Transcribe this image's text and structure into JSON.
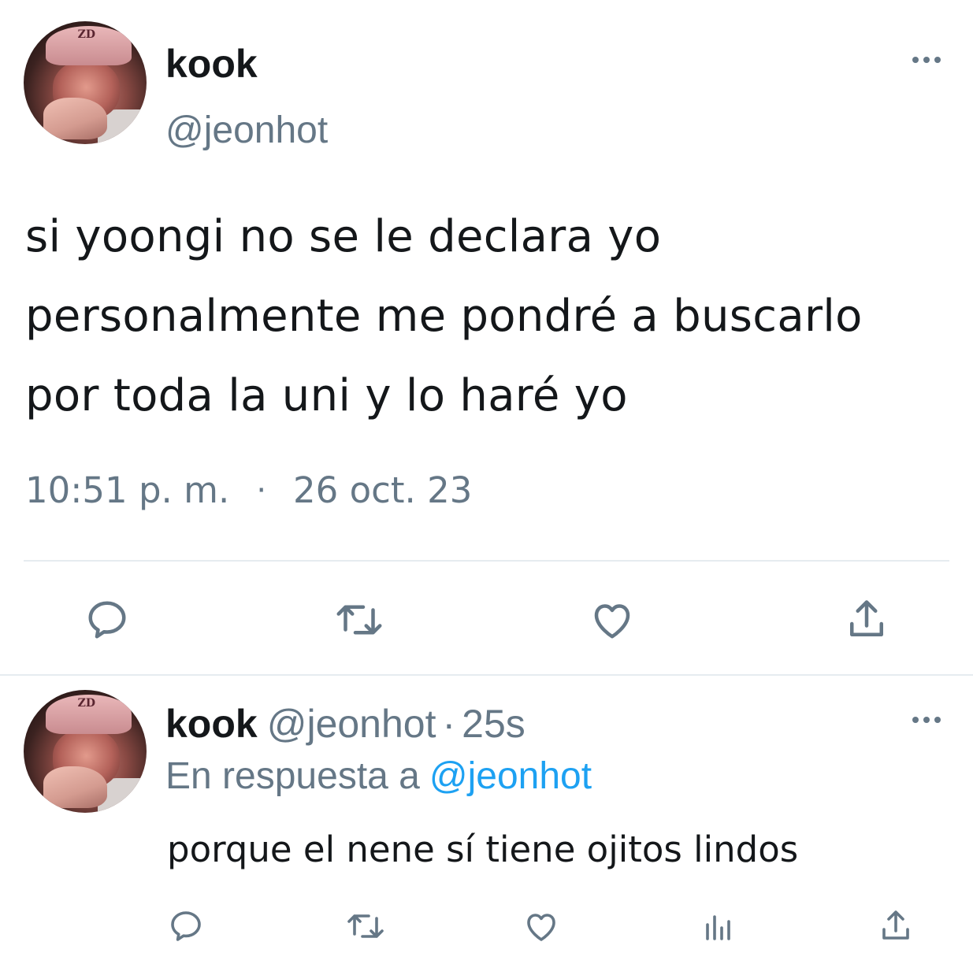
{
  "tweet": {
    "author_name": "kook",
    "author_handle": "@jeonhot",
    "avatar_cap_text": "ZD",
    "text_lines": [
      "si yoongi no se le declara yo",
      "personalmente me pondré a buscarlo",
      "por toda la uni y lo haré yo"
    ],
    "time": "10:51 p. m.",
    "separator": "·",
    "date": "26 oct. 23",
    "actions": [
      "reply-icon",
      "retweet-icon",
      "like-icon",
      "share-icon"
    ],
    "more_icon": "more-horizontal-icon"
  },
  "reply": {
    "author_name": "kook",
    "author_handle": "@jeonhot",
    "separator": "·",
    "age": "25s",
    "avatar_cap_text": "ZD",
    "in_reply_prefix": "En respuesta a",
    "in_reply_mention": "@jeonhot",
    "text": "porque el nene sí tiene ojitos lindos",
    "actions": [
      "reply-icon",
      "retweet-icon",
      "like-icon",
      "analytics-icon",
      "share-icon"
    ],
    "more_icon": "more-horizontal-icon"
  },
  "colors": {
    "text_primary": "#14171a",
    "text_secondary": "#657786",
    "link": "#1da1f2",
    "divider": "#e6ecf0"
  }
}
